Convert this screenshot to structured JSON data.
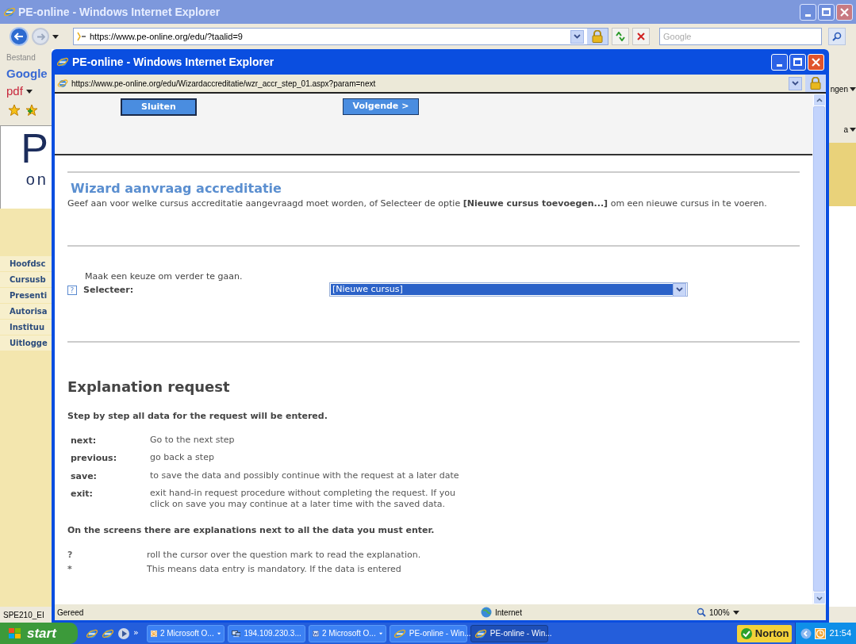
{
  "back_window": {
    "title": "PE-online - Windows Internet Explorer",
    "address": "https://www.pe-online.org/edu/?taalid=9",
    "search_placeholder": "Google",
    "menu_item": "Bestand",
    "toolbar_labels": [
      "Google",
      "pdf"
    ],
    "logo": [
      "P",
      "on"
    ],
    "nav": [
      "Hoofdsc",
      "Cursusb",
      "Presenti",
      "Autorisa",
      "Instituu",
      "Uitlogge"
    ],
    "right_labels": [
      "ngen",
      "a"
    ],
    "status": "SPE210_EI"
  },
  "front_window": {
    "title": "PE-online - Windows Internet Explorer",
    "address": "https://www.pe-online.org/edu/Wizardaccreditatie/wzr_accr_step_01.aspx?param=next",
    "buttons": [
      {
        "label": "Sluiten"
      },
      {
        "label": "Volgende >"
      }
    ],
    "wizard": {
      "title": "Wizard aanvraag accreditatie",
      "description": "Geef aan voor welke cursus accreditatie aangevraagd moet worden, of Selecteer de optie **[Nieuwe cursus toevoegen...]** om een nieuwe cursus in te voeren."
    },
    "select": {
      "prompt": "Maak een keuze om verder te gaan.",
      "help": "?",
      "label": "Selecteer:",
      "value": "[Nieuwe cursus]"
    },
    "explanation": {
      "title": "Explanation request",
      "intro": "Step by step all data for the request will be entered.",
      "terms": [
        {
          "term": "next:",
          "desc": "Go to the next step"
        },
        {
          "term": "previous:",
          "desc": "go back a step"
        },
        {
          "term": "save:",
          "desc": "to save the data and possibly continue with the request at a later date"
        },
        {
          "term": "exit:",
          "desc": "exit hand-in request procedure without completing the request. If you click on save you may continue at a later time with the saved data."
        }
      ],
      "note": "On the screens there are explanations next to all the data you must enter.",
      "symbols": [
        {
          "symbol": "?",
          "desc": "roll the cursor over the question mark to read the explanation."
        },
        {
          "symbol": "*",
          "desc": "This means data entry is mandatory. If the data is entered"
        }
      ]
    },
    "status": "Gereed",
    "zone": "Internet",
    "zoom": "100%"
  },
  "taskbar": {
    "start": "start",
    "more": "»",
    "items": [
      {
        "label": "2 Microsoft O...",
        "kind": "clock",
        "selected": false,
        "menu": true
      },
      {
        "label": "194.109.230.3...",
        "kind": "network",
        "selected": false,
        "menu": false
      },
      {
        "label": "2 Microsoft O...",
        "kind": "word",
        "selected": false,
        "menu": true
      },
      {
        "label": "PE-online - Win...",
        "kind": "browser",
        "selected": false,
        "menu": false
      },
      {
        "label": "PE-online - Win...",
        "kind": "browser",
        "selected": true,
        "menu": false
      }
    ],
    "norton": "Norton",
    "clock": "21:54"
  }
}
